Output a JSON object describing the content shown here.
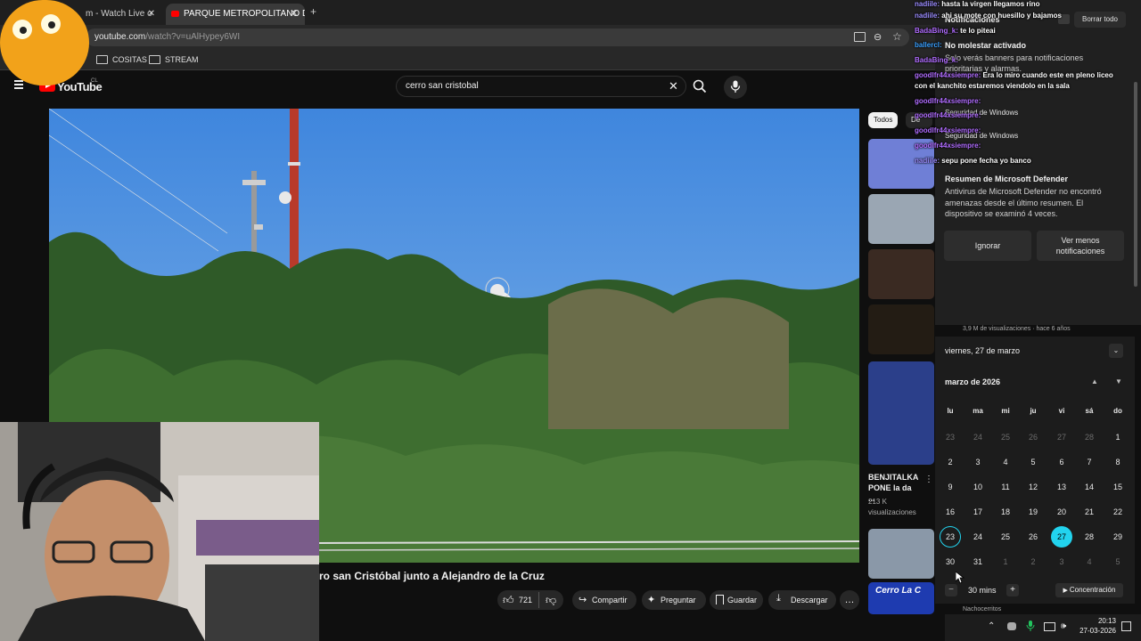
{
  "browser": {
    "tabs": [
      {
        "title": "m - Watch Live o",
        "active": false
      },
      {
        "title": "PARQUE METROPOLITANO DE",
        "active": true
      }
    ],
    "new_tab": "+",
    "url_host": "youtube.com",
    "url_path": "/watch?v=uAlHypey6WI",
    "bookmarks": [
      "COSITAS",
      "STREAM"
    ]
  },
  "youtube": {
    "logo_text": "YouTube",
    "country": "CL",
    "search_value": "cerro san cristobal",
    "video_title": "ro san Cristóbal junto a Alejandro de la Cruz",
    "like_count": "721",
    "actions": [
      "Compartir",
      "Preguntar",
      "Guardar",
      "Descargar"
    ],
    "more": "…",
    "chips": [
      "Todos",
      "De tu"
    ],
    "recommended": {
      "title": "BENJITALKA PONE la da ...",
      "views": "213 K",
      "views_label": "visualizaciones",
      "meta": "3,9 M de visualizaciones · hace 6 años",
      "thumb_text": "Cerro La C",
      "channel": "Nachocerritos"
    }
  },
  "notifications": {
    "header": "Notificaciones",
    "clear_all": "Borrar todo",
    "dnd_title": "No molestar activado",
    "dnd_body": "Solo verás banners para notificaciones prioritarias y alarmas.",
    "app": "Seguridad de Windows",
    "app2": "Seguridad de Windows",
    "card_title": "Resumen de Microsoft Defender",
    "card_body": "Antivirus de Microsoft Defender no encontró amenazas desde el último resumen. El dispositivo se examinó 4 veces.",
    "btn_ignore": "Ignorar",
    "btn_less": "Ver menos notificaciones"
  },
  "calendar": {
    "date_header": "viernes, 27 de marzo",
    "month_label": "marzo de 2026",
    "weekdays": [
      "lu",
      "ma",
      "mi",
      "ju",
      "vi",
      "sá",
      "do"
    ],
    "weeks": [
      [
        "23",
        "24",
        "25",
        "26",
        "27",
        "28",
        "1"
      ],
      [
        "2",
        "3",
        "4",
        "5",
        "6",
        "7",
        "8"
      ],
      [
        "9",
        "10",
        "11",
        "12",
        "13",
        "14",
        "15"
      ],
      [
        "16",
        "17",
        "18",
        "19",
        "20",
        "21",
        "22"
      ],
      [
        "23",
        "24",
        "25",
        "26",
        "27",
        "28",
        "29"
      ],
      [
        "30",
        "31",
        "1",
        "2",
        "3",
        "4",
        "5"
      ]
    ],
    "focus_minus": "−",
    "focus_time": "30 mins",
    "focus_plus": "+",
    "focus_button": "Concentración"
  },
  "chat": [
    {
      "user": "nadiile:",
      "msg": "hasta la virgen llegamos rino",
      "color": "#9b8cff"
    },
    {
      "user": "nadiile:",
      "msg": "ahi su mote con huesillo y bajamos",
      "color": "#9b8cff"
    },
    {
      "user": "ballercl:",
      "msg": "",
      "color": "#3aa0ff"
    },
    {
      "user": "BadaBing_k:",
      "msg": "te lo piteai",
      "color": "#b06cff"
    },
    {
      "user": "BadaBing_k:",
      "msg": "",
      "color": "#b06cff"
    },
    {
      "user": "goodlfr44xsiempre:",
      "msg": "Era lo miro cuando este en pleno liceo",
      "color": "#b06cff"
    },
    {
      "user": "",
      "msg": "con el kanchito estaremos viendolo en la sala",
      "color": "#ffffff"
    },
    {
      "user": "goodlfr44xsiempre:",
      "msg": "",
      "color": "#b06cff"
    },
    {
      "user": "goodlfr44xsiempre:",
      "msg": "",
      "color": "#b06cff"
    },
    {
      "user": "goodlfr44xsiempre:",
      "msg": "",
      "color": "#b06cff"
    },
    {
      "user": "goodlfr44xsiempre:",
      "msg": "",
      "color": "#b06cff"
    },
    {
      "user": "nadiile:",
      "msg": "sepu pone fecha yo banco",
      "color": "#9b8cff"
    }
  ],
  "taskbar": {
    "time": "20:13",
    "date": "27-03-2026"
  },
  "colors": {
    "accent_today": "#22d3ee",
    "youtube_red": "#ff0000"
  }
}
